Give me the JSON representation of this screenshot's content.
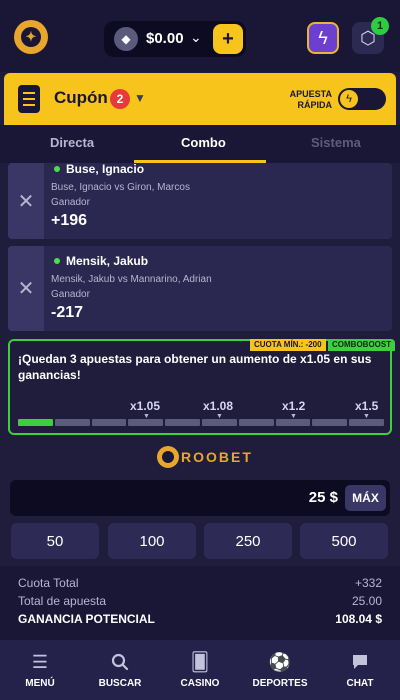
{
  "header": {
    "balance": "$0.00",
    "chevron": "⌄",
    "plus": "+",
    "notification_count": "1"
  },
  "coupon": {
    "title": "Cupón",
    "count": "2",
    "quick_bet_label": "APUESTA RÁPIDA",
    "quick_bet_on": false
  },
  "tabs": [
    {
      "label": "Directa",
      "active": false
    },
    {
      "label": "Combo",
      "active": true
    },
    {
      "label": "Sistema",
      "active": false
    }
  ],
  "bets": [
    {
      "selection": "Buse, Ignacio",
      "match": "Buse, Ignacio vs Giron, Marcos",
      "market": "Ganador",
      "odds": "+196"
    },
    {
      "selection": "Mensik, Jakub",
      "match": "Mensik, Jakub vs Mannarino, Adrian",
      "market": "Ganador",
      "odds": "-217"
    }
  ],
  "boost": {
    "min_odds_tag": "CUOTA MÍN.: -200",
    "combo_tag": "COMBOBOOST",
    "message": "¡Quedan 3 apuestas para obtener un aumento de x1.05 en sus ganancias!",
    "multipliers": [
      "x1.05",
      "x1.08",
      "x1.2",
      "x1.5"
    ],
    "segments_total": 10,
    "segments_filled": 1
  },
  "brand": {
    "name": "ROOBET"
  },
  "stake": {
    "value": "25 $",
    "max_label": "MÁX"
  },
  "quick_amounts": [
    "50",
    "100",
    "250",
    "500"
  ],
  "summary": {
    "total_odds_label": "Cuota Total",
    "total_odds_value": "+332",
    "total_stake_label": "Total de apuesta",
    "total_stake_value": "25.00",
    "potential_label": "GANANCIA POTENCIAL",
    "potential_value": "108.04 $"
  },
  "nav": [
    {
      "label": "MENÚ",
      "icon": "menu-icon"
    },
    {
      "label": "BUSCAR",
      "icon": "search-icon"
    },
    {
      "label": "CASINO",
      "icon": "casino-icon"
    },
    {
      "label": "DEPORTES",
      "icon": "sports-icon"
    },
    {
      "label": "CHAT",
      "icon": "chat-icon"
    }
  ],
  "colors": {
    "background": "#1f1c3c",
    "accent": "#f7c41b",
    "boost_green": "#3dcf3d",
    "badge_red": "#e83a3a"
  }
}
